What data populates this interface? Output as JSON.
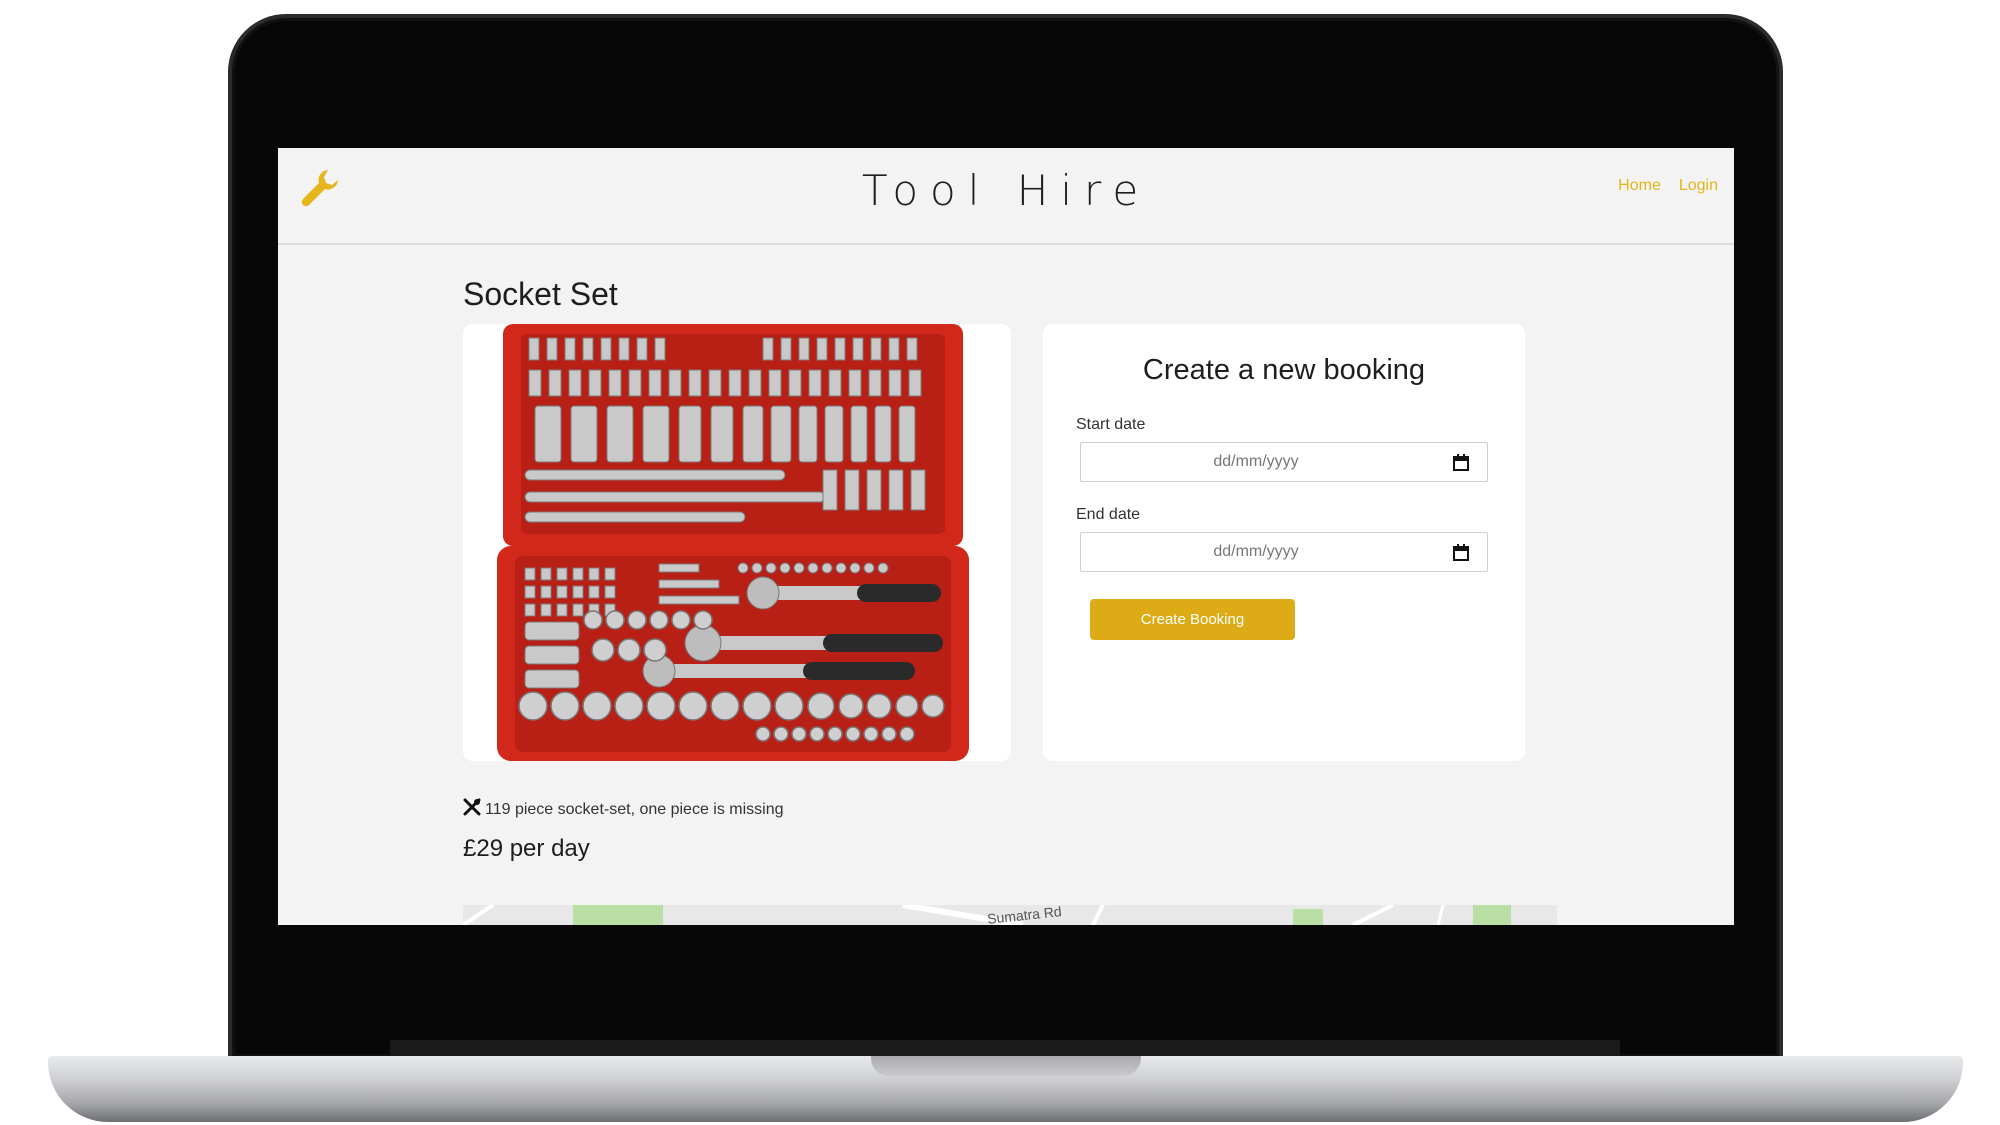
{
  "app": {
    "brand": "Tool Hire",
    "accent_color": "#e3b41c",
    "button_color": "#dcab16"
  },
  "nav": {
    "logo_icon": "wrench-icon",
    "links": [
      {
        "label": "Home"
      },
      {
        "label": "Login"
      }
    ]
  },
  "tool": {
    "name": "Socket Set",
    "image_alt": "socket-set-photo",
    "description": "119 piece socket-set, one piece is missing",
    "description_icon": "tools-icon",
    "price": "£29 per day"
  },
  "booking": {
    "title": "Create a new booking",
    "start_label": "Start date",
    "start_placeholder": "dd/mm/yyyy",
    "end_label": "End date",
    "end_placeholder": "dd/mm/yyyy",
    "submit_label": "Create Booking"
  },
  "map": {
    "street_label": "Sumatra Rd"
  }
}
